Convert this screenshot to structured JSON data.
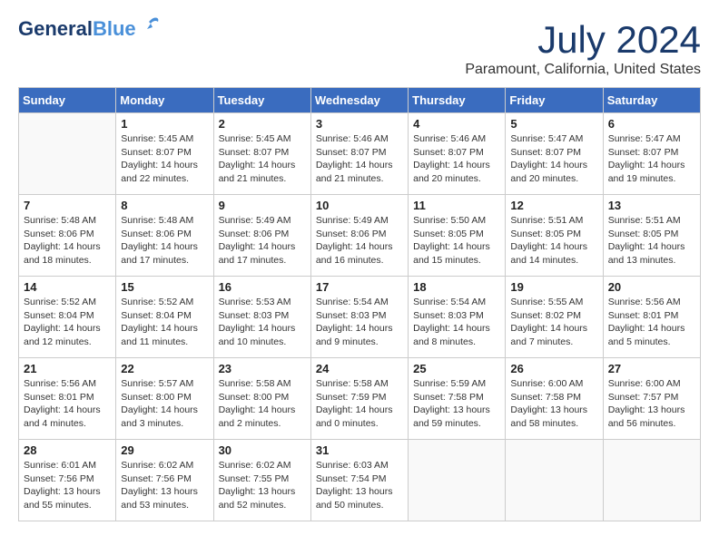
{
  "logo": {
    "line1": "General",
    "line2": "Blue",
    "bird": "🐦"
  },
  "title": {
    "month_year": "July 2024",
    "location": "Paramount, California, United States"
  },
  "days_of_week": [
    "Sunday",
    "Monday",
    "Tuesday",
    "Wednesday",
    "Thursday",
    "Friday",
    "Saturday"
  ],
  "weeks": [
    [
      {
        "day": "",
        "info": ""
      },
      {
        "day": "1",
        "info": "Sunrise: 5:45 AM\nSunset: 8:07 PM\nDaylight: 14 hours\nand 22 minutes."
      },
      {
        "day": "2",
        "info": "Sunrise: 5:45 AM\nSunset: 8:07 PM\nDaylight: 14 hours\nand 21 minutes."
      },
      {
        "day": "3",
        "info": "Sunrise: 5:46 AM\nSunset: 8:07 PM\nDaylight: 14 hours\nand 21 minutes."
      },
      {
        "day": "4",
        "info": "Sunrise: 5:46 AM\nSunset: 8:07 PM\nDaylight: 14 hours\nand 20 minutes."
      },
      {
        "day": "5",
        "info": "Sunrise: 5:47 AM\nSunset: 8:07 PM\nDaylight: 14 hours\nand 20 minutes."
      },
      {
        "day": "6",
        "info": "Sunrise: 5:47 AM\nSunset: 8:07 PM\nDaylight: 14 hours\nand 19 minutes."
      }
    ],
    [
      {
        "day": "7",
        "info": "Sunrise: 5:48 AM\nSunset: 8:06 PM\nDaylight: 14 hours\nand 18 minutes."
      },
      {
        "day": "8",
        "info": "Sunrise: 5:48 AM\nSunset: 8:06 PM\nDaylight: 14 hours\nand 17 minutes."
      },
      {
        "day": "9",
        "info": "Sunrise: 5:49 AM\nSunset: 8:06 PM\nDaylight: 14 hours\nand 17 minutes."
      },
      {
        "day": "10",
        "info": "Sunrise: 5:49 AM\nSunset: 8:06 PM\nDaylight: 14 hours\nand 16 minutes."
      },
      {
        "day": "11",
        "info": "Sunrise: 5:50 AM\nSunset: 8:05 PM\nDaylight: 14 hours\nand 15 minutes."
      },
      {
        "day": "12",
        "info": "Sunrise: 5:51 AM\nSunset: 8:05 PM\nDaylight: 14 hours\nand 14 minutes."
      },
      {
        "day": "13",
        "info": "Sunrise: 5:51 AM\nSunset: 8:05 PM\nDaylight: 14 hours\nand 13 minutes."
      }
    ],
    [
      {
        "day": "14",
        "info": "Sunrise: 5:52 AM\nSunset: 8:04 PM\nDaylight: 14 hours\nand 12 minutes."
      },
      {
        "day": "15",
        "info": "Sunrise: 5:52 AM\nSunset: 8:04 PM\nDaylight: 14 hours\nand 11 minutes."
      },
      {
        "day": "16",
        "info": "Sunrise: 5:53 AM\nSunset: 8:03 PM\nDaylight: 14 hours\nand 10 minutes."
      },
      {
        "day": "17",
        "info": "Sunrise: 5:54 AM\nSunset: 8:03 PM\nDaylight: 14 hours\nand 9 minutes."
      },
      {
        "day": "18",
        "info": "Sunrise: 5:54 AM\nSunset: 8:03 PM\nDaylight: 14 hours\nand 8 minutes."
      },
      {
        "day": "19",
        "info": "Sunrise: 5:55 AM\nSunset: 8:02 PM\nDaylight: 14 hours\nand 7 minutes."
      },
      {
        "day": "20",
        "info": "Sunrise: 5:56 AM\nSunset: 8:01 PM\nDaylight: 14 hours\nand 5 minutes."
      }
    ],
    [
      {
        "day": "21",
        "info": "Sunrise: 5:56 AM\nSunset: 8:01 PM\nDaylight: 14 hours\nand 4 minutes."
      },
      {
        "day": "22",
        "info": "Sunrise: 5:57 AM\nSunset: 8:00 PM\nDaylight: 14 hours\nand 3 minutes."
      },
      {
        "day": "23",
        "info": "Sunrise: 5:58 AM\nSunset: 8:00 PM\nDaylight: 14 hours\nand 2 minutes."
      },
      {
        "day": "24",
        "info": "Sunrise: 5:58 AM\nSunset: 7:59 PM\nDaylight: 14 hours\nand 0 minutes."
      },
      {
        "day": "25",
        "info": "Sunrise: 5:59 AM\nSunset: 7:58 PM\nDaylight: 13 hours\nand 59 minutes."
      },
      {
        "day": "26",
        "info": "Sunrise: 6:00 AM\nSunset: 7:58 PM\nDaylight: 13 hours\nand 58 minutes."
      },
      {
        "day": "27",
        "info": "Sunrise: 6:00 AM\nSunset: 7:57 PM\nDaylight: 13 hours\nand 56 minutes."
      }
    ],
    [
      {
        "day": "28",
        "info": "Sunrise: 6:01 AM\nSunset: 7:56 PM\nDaylight: 13 hours\nand 55 minutes."
      },
      {
        "day": "29",
        "info": "Sunrise: 6:02 AM\nSunset: 7:56 PM\nDaylight: 13 hours\nand 53 minutes."
      },
      {
        "day": "30",
        "info": "Sunrise: 6:02 AM\nSunset: 7:55 PM\nDaylight: 13 hours\nand 52 minutes."
      },
      {
        "day": "31",
        "info": "Sunrise: 6:03 AM\nSunset: 7:54 PM\nDaylight: 13 hours\nand 50 minutes."
      },
      {
        "day": "",
        "info": ""
      },
      {
        "day": "",
        "info": ""
      },
      {
        "day": "",
        "info": ""
      }
    ]
  ]
}
